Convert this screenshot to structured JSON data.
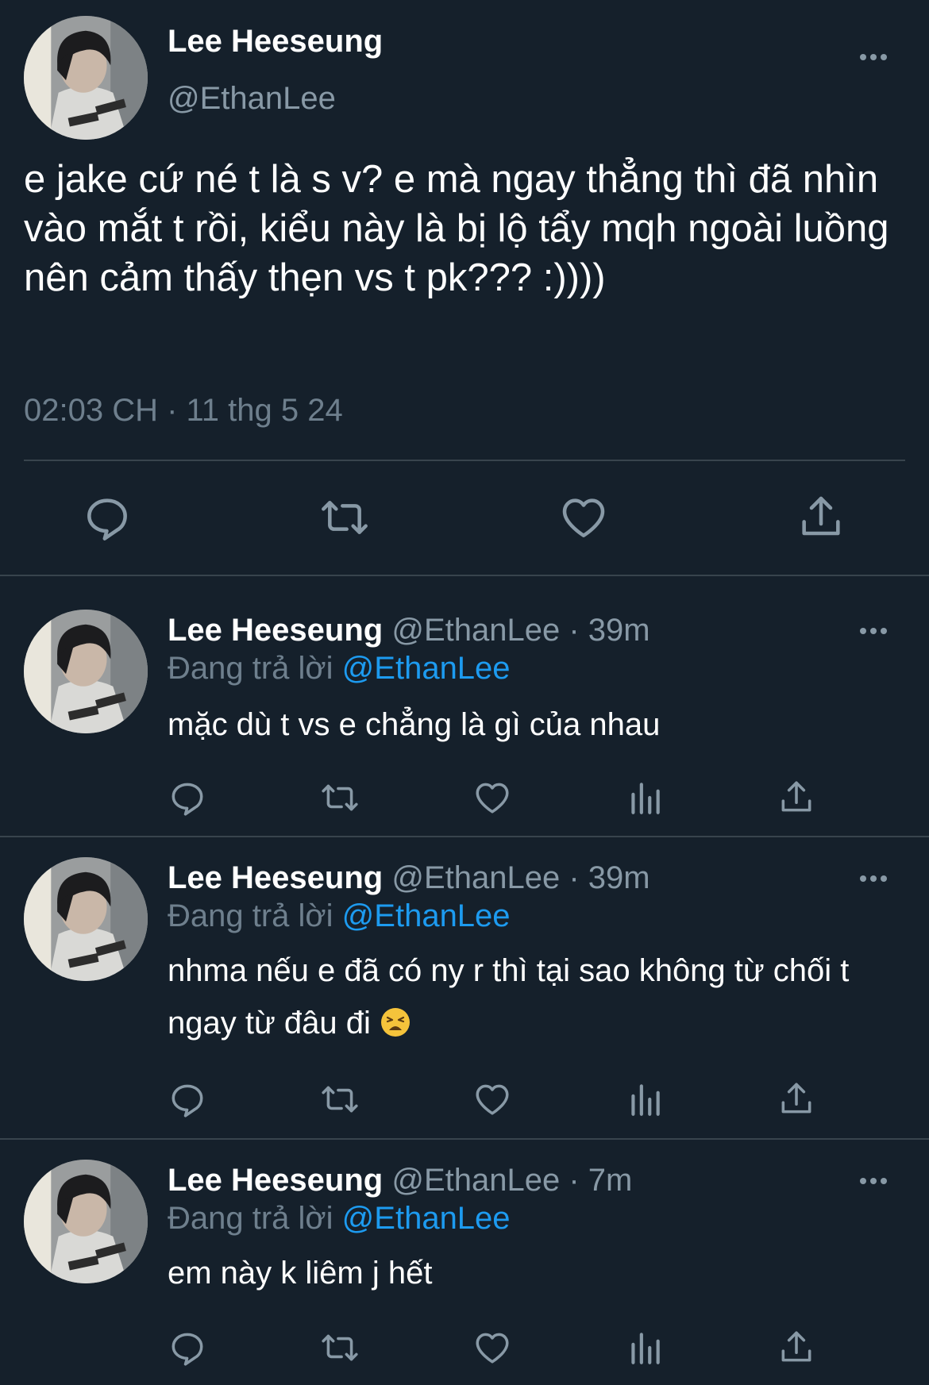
{
  "main_tweet": {
    "author_name": "Lee Heeseung",
    "author_handle": "@EthanLee",
    "text": "e jake cứ né t là s v? e mà ngay thẳng thì đã nhìn vào mắt t rồi, kiểu này là bị lộ tẩy mqh ngoài luồng nên cảm thấy thẹn vs t pk??? :))))",
    "timestamp": "02:03 CH · 11 thg 5 24",
    "actions": [
      "reply-icon",
      "retweet-icon",
      "like-icon",
      "share-icon"
    ]
  },
  "replies": [
    {
      "author_name": "Lee Heeseung",
      "author_handle": "@EthanLee",
      "separator": "·",
      "time": "39m",
      "replying_label": "Đang trả lời",
      "replying_to": "@EthanLee",
      "text": "mặc dù t vs e chẳng là gì của nhau"
    },
    {
      "author_name": "Lee Heeseung",
      "author_handle": "@EthanLee",
      "separator": "·",
      "time": "39m",
      "replying_label": "Đang trả lời",
      "replying_to": "@EthanLee",
      "text": "nhma nếu e đã có ny r thì tại sao không từ chối t ngay từ đâu đi",
      "emoji": "weary-face-emoji"
    },
    {
      "author_name": "Lee Heeseung",
      "author_handle": "@EthanLee",
      "separator": "·",
      "time": "7m",
      "replying_label": "Đang trả lời",
      "replying_to": "@EthanLee",
      "text": "em này k liêm j hết"
    }
  ],
  "colors": {
    "background": "#15202b",
    "text": "#ffffff",
    "secondary": "#8899a6",
    "mention": "#1d9bf0",
    "divider": "#38444d"
  }
}
